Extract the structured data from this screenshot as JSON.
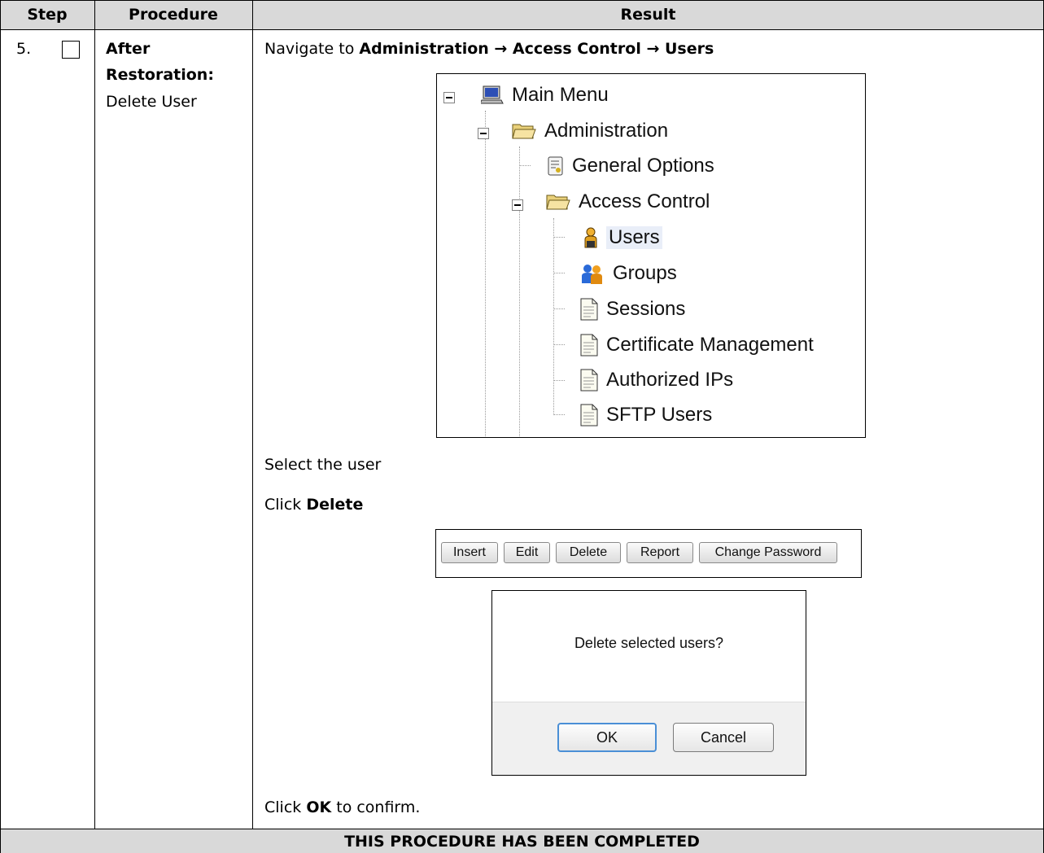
{
  "table": {
    "headers": {
      "step": "Step",
      "procedure": "Procedure",
      "result": "Result"
    },
    "row": {
      "step_number": "5.",
      "procedure_title_line1": "After",
      "procedure_title_line2": "Restoration:",
      "procedure_subtitle": "Delete User",
      "result": {
        "navigate_prefix": "Navigate to ",
        "navigate_path": "Administration → Access Control → Users",
        "select_user": "Select the user",
        "click_prefix": "Click ",
        "click_target": "Delete",
        "confirm_prefix": "Click ",
        "confirm_target": "OK",
        "confirm_suffix": " to confirm."
      }
    },
    "footer": "THIS PROCEDURE HAS BEEN COMPLETED"
  },
  "menu_tree": {
    "items": [
      {
        "label": "Main Menu",
        "icon": "computer-icon"
      },
      {
        "label": "Administration",
        "icon": "folder-open-icon"
      },
      {
        "label": "General Options",
        "icon": "options-document-icon"
      },
      {
        "label": "Access Control",
        "icon": "folder-open-icon"
      },
      {
        "label": "Users",
        "icon": "user-icon",
        "selected": true
      },
      {
        "label": "Groups",
        "icon": "group-icon"
      },
      {
        "label": "Sessions",
        "icon": "document-icon"
      },
      {
        "label": "Certificate Management",
        "icon": "document-icon"
      },
      {
        "label": "Authorized IPs",
        "icon": "document-icon"
      },
      {
        "label": "SFTP Users",
        "icon": "document-icon"
      }
    ]
  },
  "button_bar": {
    "buttons": [
      "Insert",
      "Edit",
      "Delete",
      "Report",
      "Change Password"
    ]
  },
  "dialog": {
    "message": "Delete selected users?",
    "ok_label": "OK",
    "cancel_label": "Cancel"
  },
  "colors": {
    "header_bg": "#d9d9d9",
    "selection_bg": "#e9eef8",
    "ok_focus_border": "#4a8fd6"
  }
}
